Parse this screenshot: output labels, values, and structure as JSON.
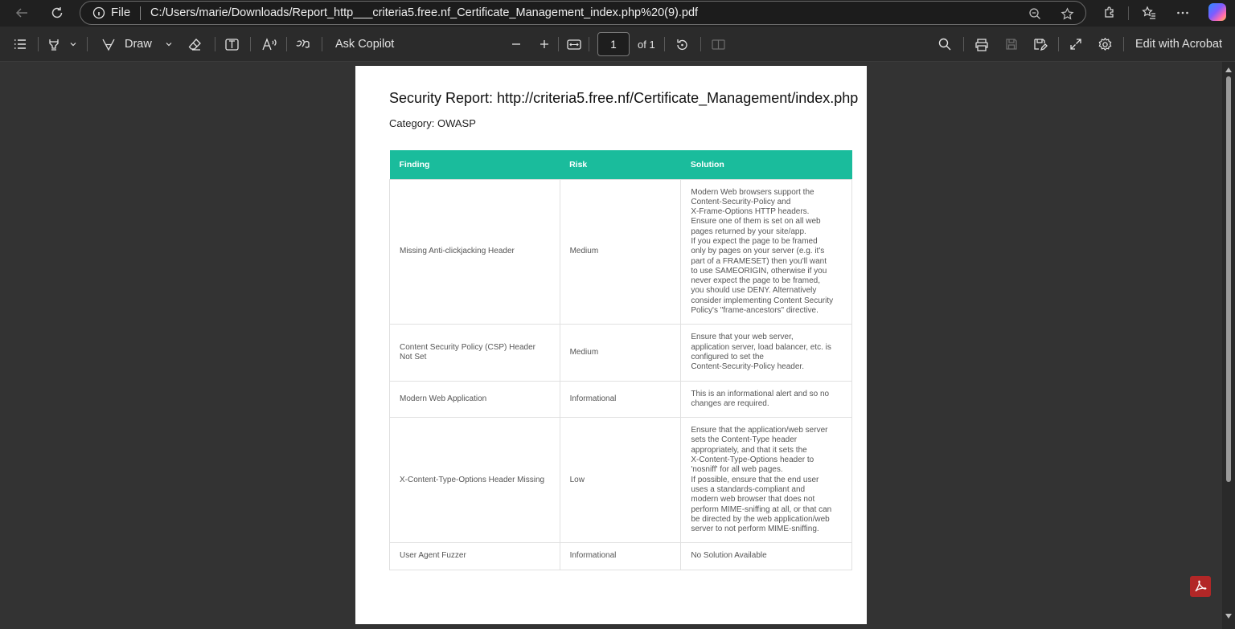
{
  "browser": {
    "file_label": "File",
    "url": "C:/Users/marie/Downloads/Report_http___criteria5.free.nf_Certificate_Management_index.php%20(9).pdf"
  },
  "pdf_toolbar": {
    "draw_label": "Draw",
    "ask_copilot_label": "Ask Copilot",
    "current_page": "1",
    "page_count_label": "of 1",
    "edit_label": "Edit with Acrobat"
  },
  "document": {
    "title": "Security Report: http://criteria5.free.nf/Certificate_Management/index.php",
    "category": "Category: OWASP",
    "columns": [
      "Finding",
      "Risk",
      "Solution"
    ],
    "rows": [
      {
        "finding": "Missing Anti-clickjacking Header",
        "risk": "Medium",
        "solution": "Modern Web browsers support the\nContent-Security-Policy and\nX-Frame-Options HTTP headers.\nEnsure one of them is set on all web\npages returned by your site/app.\nIf you expect the page to be framed\nonly by pages on your server (e.g. it's\npart of a FRAMESET) then you'll want\nto use SAMEORIGIN, otherwise if you\nnever expect the page to be framed,\nyou should use DENY. Alternatively\nconsider implementing Content Security\nPolicy's \"frame-ancestors\" directive."
      },
      {
        "finding": "Content Security Policy (CSP) Header Not Set",
        "risk": "Medium",
        "solution": "Ensure that your web server,\napplication server, load balancer, etc. is\nconfigured to set the\nContent-Security-Policy header."
      },
      {
        "finding": "Modern Web Application",
        "risk": "Informational",
        "solution": "This is an informational alert and so no\nchanges are required."
      },
      {
        "finding": "X-Content-Type-Options Header Missing",
        "risk": "Low",
        "solution": "Ensure that the application/web server\nsets the Content-Type header\nappropriately, and that it sets the\nX-Content-Type-Options header to\n'nosniff' for all web pages.\nIf possible, ensure that the end user\nuses a standards-compliant and\nmodern web browser that does not\nperform MIME-sniffing at all, or that can\nbe directed by the web application/web\nserver to not perform MIME-sniffing."
      },
      {
        "finding": "User Agent Fuzzer",
        "risk": "Informational",
        "solution": "No Solution Available"
      }
    ]
  },
  "colors": {
    "table_header": "#1abc9c",
    "acrobat_badge": "#b22727"
  }
}
